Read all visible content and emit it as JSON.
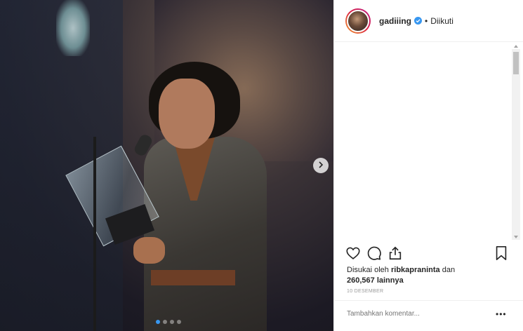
{
  "post": {
    "username": "gadiiing",
    "separator": "•",
    "follow_status": "Diikuti",
    "liked_by_prefix": "Disukai oleh",
    "liked_by_user": "ribkapraninta",
    "liked_by_and": "dan",
    "likes_count": "260,567",
    "likes_suffix": "lainnya",
    "date": "10 DESEMBER",
    "comment_placeholder": "Tambahkan komentar...",
    "more_label": "•••"
  },
  "carousel": {
    "total_slides": 4,
    "active_slide": 1
  },
  "icons": {
    "like": "heart-icon",
    "comment": "comment-icon",
    "share": "share-icon",
    "save": "bookmark-icon",
    "next": "chevron-right-icon",
    "verified": "verified-badge-icon"
  },
  "colors": {
    "accent": "#3897f0",
    "text": "#262626",
    "muted": "#999999"
  }
}
